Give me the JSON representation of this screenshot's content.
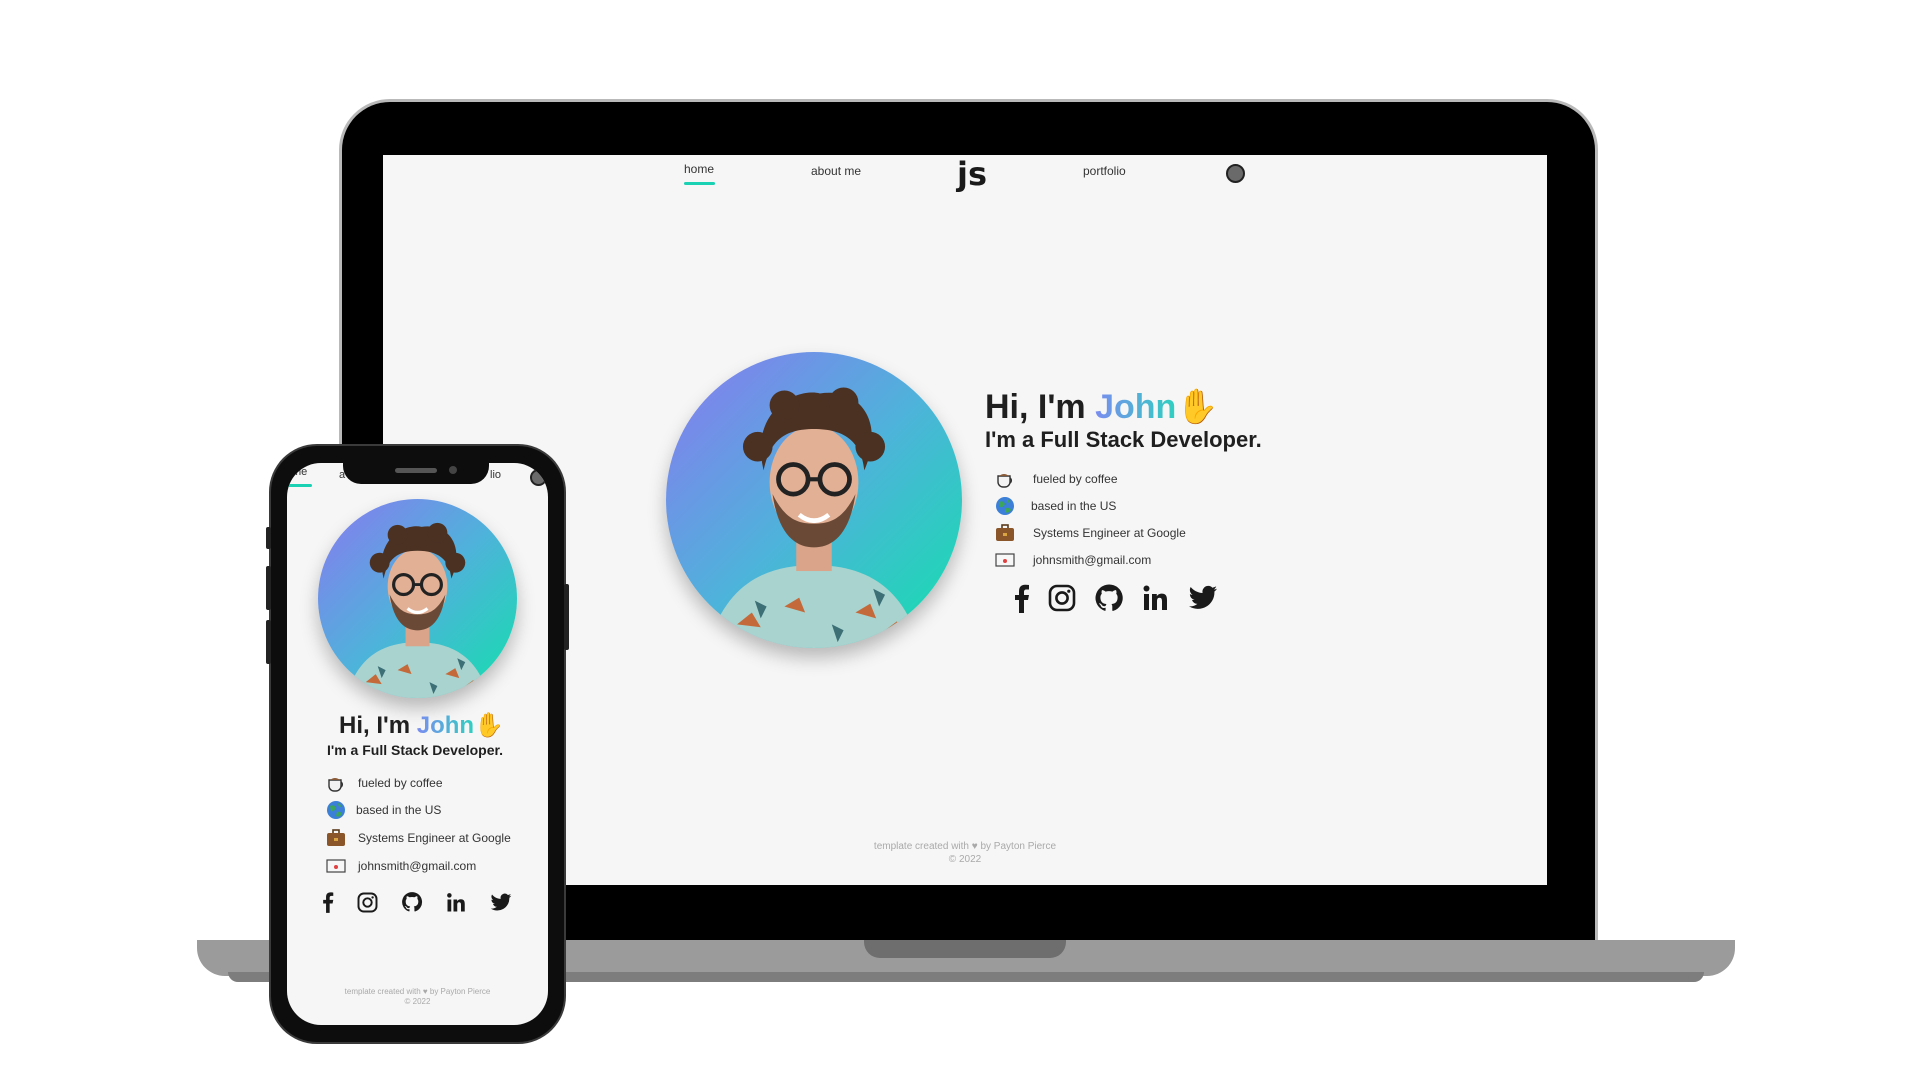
{
  "site": {
    "nav": {
      "home": "home",
      "about": "about me",
      "logo": "js",
      "portfolio": "portfolio"
    },
    "hero": {
      "greeting_prefix": "Hi, I'm ",
      "name": "John",
      "wave": "✋",
      "subtitle": "I'm a Full Stack Developer."
    },
    "facts": [
      {
        "icon": "coffee-icon",
        "text": "fueled by coffee"
      },
      {
        "icon": "globe-icon",
        "text": "based in the US"
      },
      {
        "icon": "briefcase-icon",
        "text": "Systems Engineer at Google"
      },
      {
        "icon": "envelope-icon",
        "text": "johnsmith@gmail.com"
      }
    ],
    "socials": [
      "facebook-icon",
      "instagram-icon",
      "github-icon",
      "linkedin-icon",
      "twitter-icon"
    ],
    "footer": {
      "credit": "template created with ♥ by Payton Pierce",
      "copyright": "© 2022"
    }
  },
  "phone_nav": {
    "home_partial": "me",
    "about_partial": "a",
    "portfolio_partial": "lio"
  },
  "colors": {
    "accent": "#1ad1b3",
    "gradient_start": "#8a78f0",
    "gradient_end": "#12e0ac",
    "background": "#f6f6f6",
    "text": "#1f1f1f"
  }
}
